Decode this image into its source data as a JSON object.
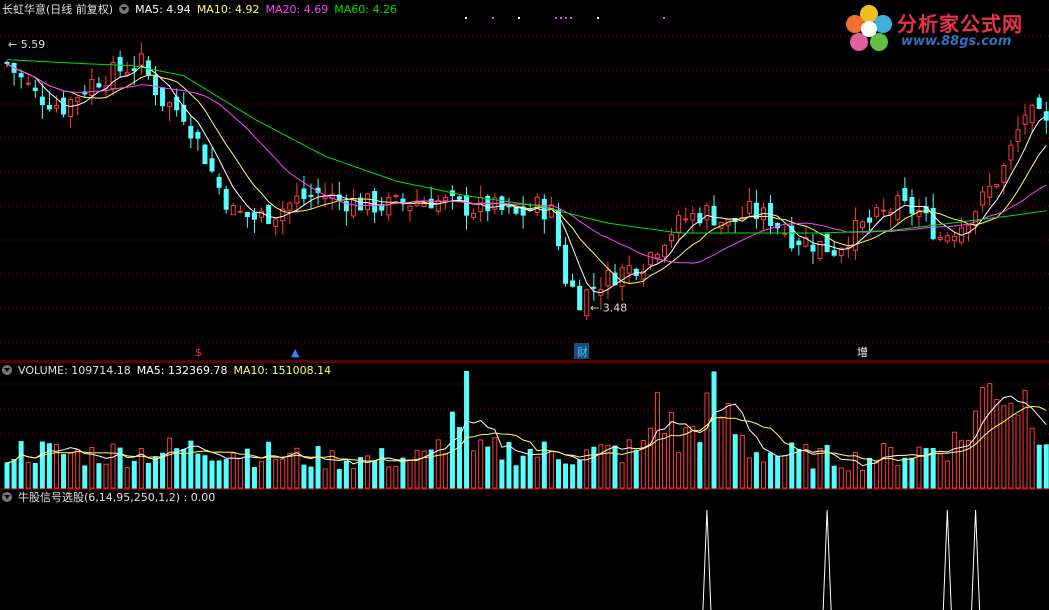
{
  "main_pane": {
    "title": "长虹华意(日线 前复权)",
    "ma5_label": "MA5: 4.94",
    "ma10_label": "MA10: 4.92",
    "ma20_label": "MA20: 4.69",
    "ma60_label": "MA60: 4.26",
    "high_marker": "5.59",
    "low_marker": "3.48",
    "event_markers": [
      "$",
      "▲",
      "财",
      "增"
    ]
  },
  "volume_pane": {
    "volume_label": "VOLUME: 109714.18",
    "ma5_label": "MA5: 132369.78",
    "ma10_label": "MA10: 151008.14"
  },
  "indicator_pane": {
    "label": "牛股信号选股(6,14,95,250,1,2) : 0.00"
  },
  "logo": {
    "name": "分析家公式网",
    "url": "www.88gs.com"
  },
  "colors": {
    "up": "#ff3c3c",
    "down": "#54ffff",
    "ma5": "#ffffff",
    "ma10": "#ffff64",
    "ma20": "#ff40ff",
    "ma60": "#00e000",
    "grid": "#8b0000",
    "divider": "#b00000"
  },
  "chart_data": [
    {
      "type": "candlestick",
      "title": "长虹华意(日线 前复权)",
      "ylim": [
        3.2,
        5.8
      ],
      "series": [
        {
          "name": "MA5",
          "last": 4.94
        },
        {
          "name": "MA10",
          "last": 4.92
        },
        {
          "name": "MA20",
          "last": 4.69
        },
        {
          "name": "MA60",
          "last": 4.26
        }
      ],
      "max_price": 5.59,
      "min_price": 3.48,
      "close_keypoints": [
        [
          0,
          5.45
        ],
        [
          4,
          5.2
        ],
        [
          8,
          5.1
        ],
        [
          12,
          5.3
        ],
        [
          16,
          5.4
        ],
        [
          19,
          5.45
        ],
        [
          22,
          5.15
        ],
        [
          25,
          5.05
        ],
        [
          28,
          4.7
        ],
        [
          30,
          4.45
        ],
        [
          32,
          4.25
        ],
        [
          35,
          4.2
        ],
        [
          38,
          4.25
        ],
        [
          41,
          4.35
        ],
        [
          44,
          4.4
        ],
        [
          47,
          4.35
        ],
        [
          50,
          4.32
        ],
        [
          53,
          4.3
        ],
        [
          56,
          4.32
        ],
        [
          60,
          4.35
        ],
        [
          64,
          4.3
        ],
        [
          66,
          4.28
        ],
        [
          68,
          4.3
        ],
        [
          72,
          4.22
        ],
        [
          75,
          4.3
        ],
        [
          77,
          4.25
        ],
        [
          79,
          3.72
        ],
        [
          81,
          3.55
        ],
        [
          83,
          3.65
        ],
        [
          86,
          3.75
        ],
        [
          90,
          3.85
        ],
        [
          93,
          4.05
        ],
        [
          96,
          4.2
        ],
        [
          99,
          4.25
        ],
        [
          102,
          4.15
        ],
        [
          105,
          4.25
        ],
        [
          108,
          4.2
        ],
        [
          111,
          4.05
        ],
        [
          114,
          4.0
        ],
        [
          117,
          3.95
        ],
        [
          120,
          4.1
        ],
        [
          123,
          4.2
        ],
        [
          126,
          4.3
        ],
        [
          129,
          4.25
        ],
        [
          132,
          4.05
        ],
        [
          135,
          4.15
        ],
        [
          138,
          4.35
        ],
        [
          141,
          4.6
        ],
        [
          144,
          5.05
        ],
        [
          146,
          5.0
        ],
        [
          147,
          4.94
        ]
      ],
      "ma60_keypoints": [
        [
          0,
          5.48
        ],
        [
          10,
          5.45
        ],
        [
          18,
          5.43
        ],
        [
          25,
          5.35
        ],
        [
          35,
          5.0
        ],
        [
          45,
          4.7
        ],
        [
          55,
          4.5
        ],
        [
          65,
          4.38
        ],
        [
          75,
          4.3
        ],
        [
          85,
          4.16
        ],
        [
          95,
          4.08
        ],
        [
          105,
          4.08
        ],
        [
          115,
          4.08
        ],
        [
          125,
          4.1
        ],
        [
          135,
          4.17
        ],
        [
          142,
          4.22
        ],
        [
          147,
          4.26
        ]
      ]
    },
    {
      "type": "bar",
      "title": "VOLUME",
      "series": [
        {
          "name": "VOLUME",
          "last": 109714.18
        },
        {
          "name": "MA5",
          "last": 132369.78
        },
        {
          "name": "MA10",
          "last": 151008.14
        }
      ],
      "volume_keypoints": [
        [
          0,
          40
        ],
        [
          10,
          35
        ],
        [
          20,
          38
        ],
        [
          30,
          42
        ],
        [
          40,
          32
        ],
        [
          50,
          30
        ],
        [
          60,
          32
        ],
        [
          65,
          90
        ],
        [
          66,
          35
        ],
        [
          70,
          40
        ],
        [
          80,
          35
        ],
        [
          90,
          40
        ],
        [
          92,
          95
        ],
        [
          95,
          45
        ],
        [
          100,
          90
        ],
        [
          105,
          40
        ],
        [
          110,
          35
        ],
        [
          120,
          30
        ],
        [
          130,
          40
        ],
        [
          135,
          50
        ],
        [
          140,
          120
        ],
        [
          142,
          100
        ],
        [
          145,
          90
        ],
        [
          147,
          60
        ]
      ]
    },
    {
      "type": "line",
      "title": "牛股信号选股(6,14,95,250,1,2)",
      "series": [
        {
          "name": "牛股信号选股",
          "last": 0.0
        }
      ],
      "signal_bars": [
        99,
        116,
        133,
        137
      ]
    }
  ]
}
